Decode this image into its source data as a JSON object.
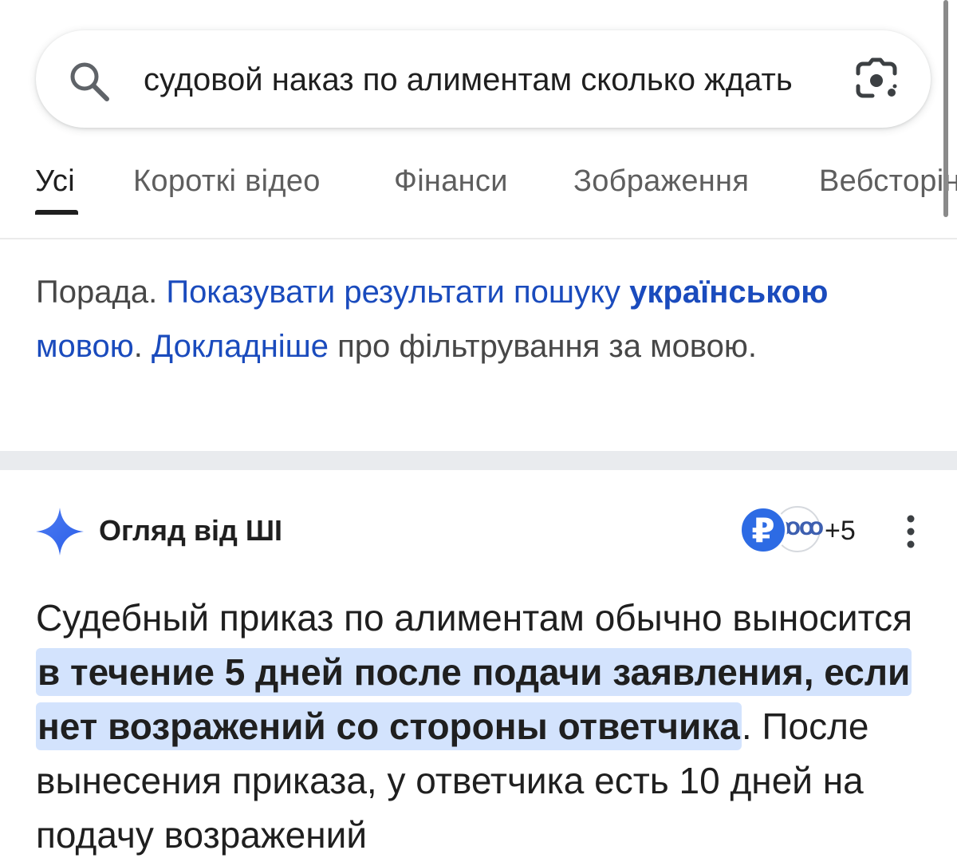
{
  "search": {
    "query": "судовой наказ по алиментам сколько ждать",
    "search_icon": "search-icon",
    "lens_icon": "google-lens-camera-icon"
  },
  "tabs": [
    {
      "label": "Усі",
      "active": true
    },
    {
      "label": "Короткі відео",
      "active": false
    },
    {
      "label": "Фінанси",
      "active": false
    },
    {
      "label": "Зображення",
      "active": false
    },
    {
      "label": "Вебсторінки",
      "active": false
    }
  ],
  "tip": {
    "prefix": "Порада. ",
    "link1_part1": "Показувати результати пошуку ",
    "link1_bold": "українською",
    "link1_part2": " мовою",
    "mid": ". ",
    "link2": "Докладніше",
    "suffix": " про фільтрування за мовою."
  },
  "ai_overview": {
    "title": "Огляд від ШІ",
    "source_a_glyph": "₽",
    "source_b_glyph": "ꝎꝎ",
    "sources_more": "+5",
    "more_icon": "more-vert-icon",
    "body_start": "Судебный приказ по алиментам обычно выносится ",
    "body_highlight": "в течение 5 дней после подачи заявления, если нет возражений со стороны ответчика",
    "body_end": ". После вынесения приказа, у ответчика есть 10 дней на подачу возражений"
  },
  "colors": {
    "link_blue": "#1a4bbd",
    "highlight": "#d3e3fd",
    "source_blue": "#2d6be4",
    "separator": "#e9ebee"
  }
}
